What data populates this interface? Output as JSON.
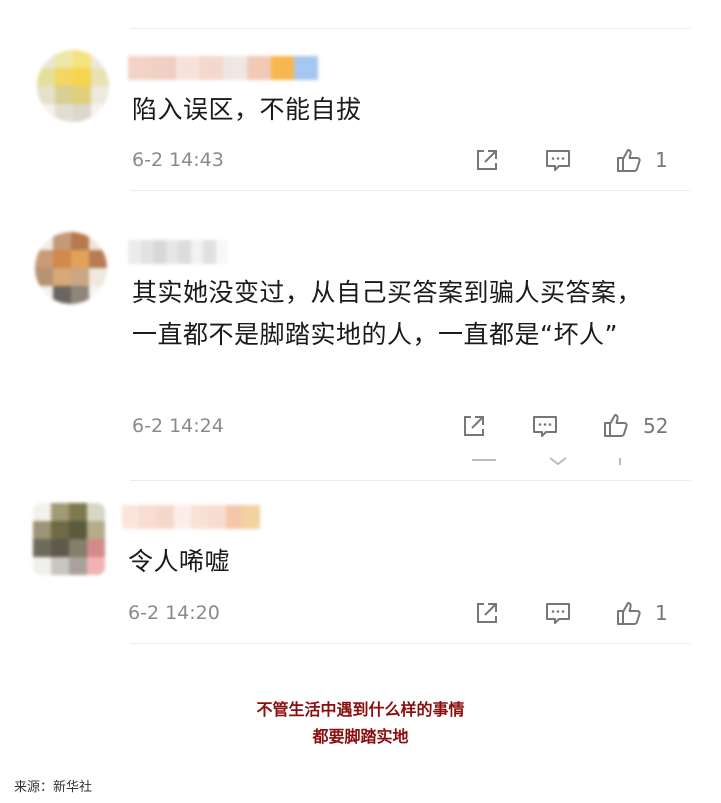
{
  "comments": [
    {
      "text": "陷入误区，不能自拔",
      "time": "6-2 14:43",
      "likes": "1",
      "avatar_colors": [
        "#e9e6d6",
        "#efe7a8",
        "#f4e37e",
        "#ece9da",
        "#e4df9a",
        "#f3d760",
        "#f6d54e",
        "#e8e2b5",
        "#e5e0c9",
        "#d8cf93",
        "#e0cf7a",
        "#ede9de",
        "#f2f1ec",
        "#e2ddd3",
        "#dcd7cb",
        "#f5f4f1"
      ],
      "username_colors": [
        "#f2d3c6",
        "#f0cfc3",
        "#f6e2da",
        "#f4d8cd",
        "#f0e6e2",
        "#f1c9b6",
        "#f7b64f",
        "#a6c7f0"
      ]
    },
    {
      "text": "其实她没变过，从自己买答案到骗人买答案，一直都不是脚踏实地的人，一直都是“坏人”",
      "time": "6-2 14:24",
      "likes": "52",
      "avatar_colors": [
        "#f1ece7",
        "#c49a78",
        "#b67a4e",
        "#efe6dd",
        "#c89c78",
        "#d08a4a",
        "#e2a25a",
        "#b87c52",
        "#b79374",
        "#d8a878",
        "#caa682",
        "#f0e8e0",
        "#f4f1ee",
        "#6b6662",
        "#8e857d",
        "#f7f5f2"
      ],
      "username_colors": [
        "#ececec",
        "#e2e2e2",
        "#d8d8d8",
        "#e6e6e6",
        "#dcdcdc",
        "#f2f2f2",
        "#e0e0e0",
        "#f7f7f7"
      ]
    },
    {
      "text": "令人唏嘘",
      "time": "6-2 14:20",
      "likes": "1",
      "avatar_colors": [
        "#f3f1ec",
        "#a39a76",
        "#7d7a4e",
        "#d9d6c6",
        "#9b9476",
        "#6f6a44",
        "#5a5a3c",
        "#b4ac8a",
        "#6f6b5c",
        "#5d5a4c",
        "#847e6a",
        "#d38a8a",
        "#f1efea",
        "#c8c6c0",
        "#a9a29a",
        "#f2b2b2"
      ],
      "username_colors": [
        "#fbe4da",
        "#f8ddd0",
        "#f6d8cb",
        "#fbeee8",
        "#f9e1d4",
        "#f7ddd0",
        "#f5c7a8",
        "#f3d2a0"
      ]
    }
  ],
  "caption_line1": "不管生活中遇到什么样的事情",
  "caption_line2": "都要脚踏实地",
  "source": "来源：新华社",
  "colors": {
    "caption": "#8b0e0e",
    "meta": "#8a8a8a",
    "divider": "#ececec"
  },
  "icons": [
    "share-icon",
    "comment-icon",
    "like-icon"
  ]
}
